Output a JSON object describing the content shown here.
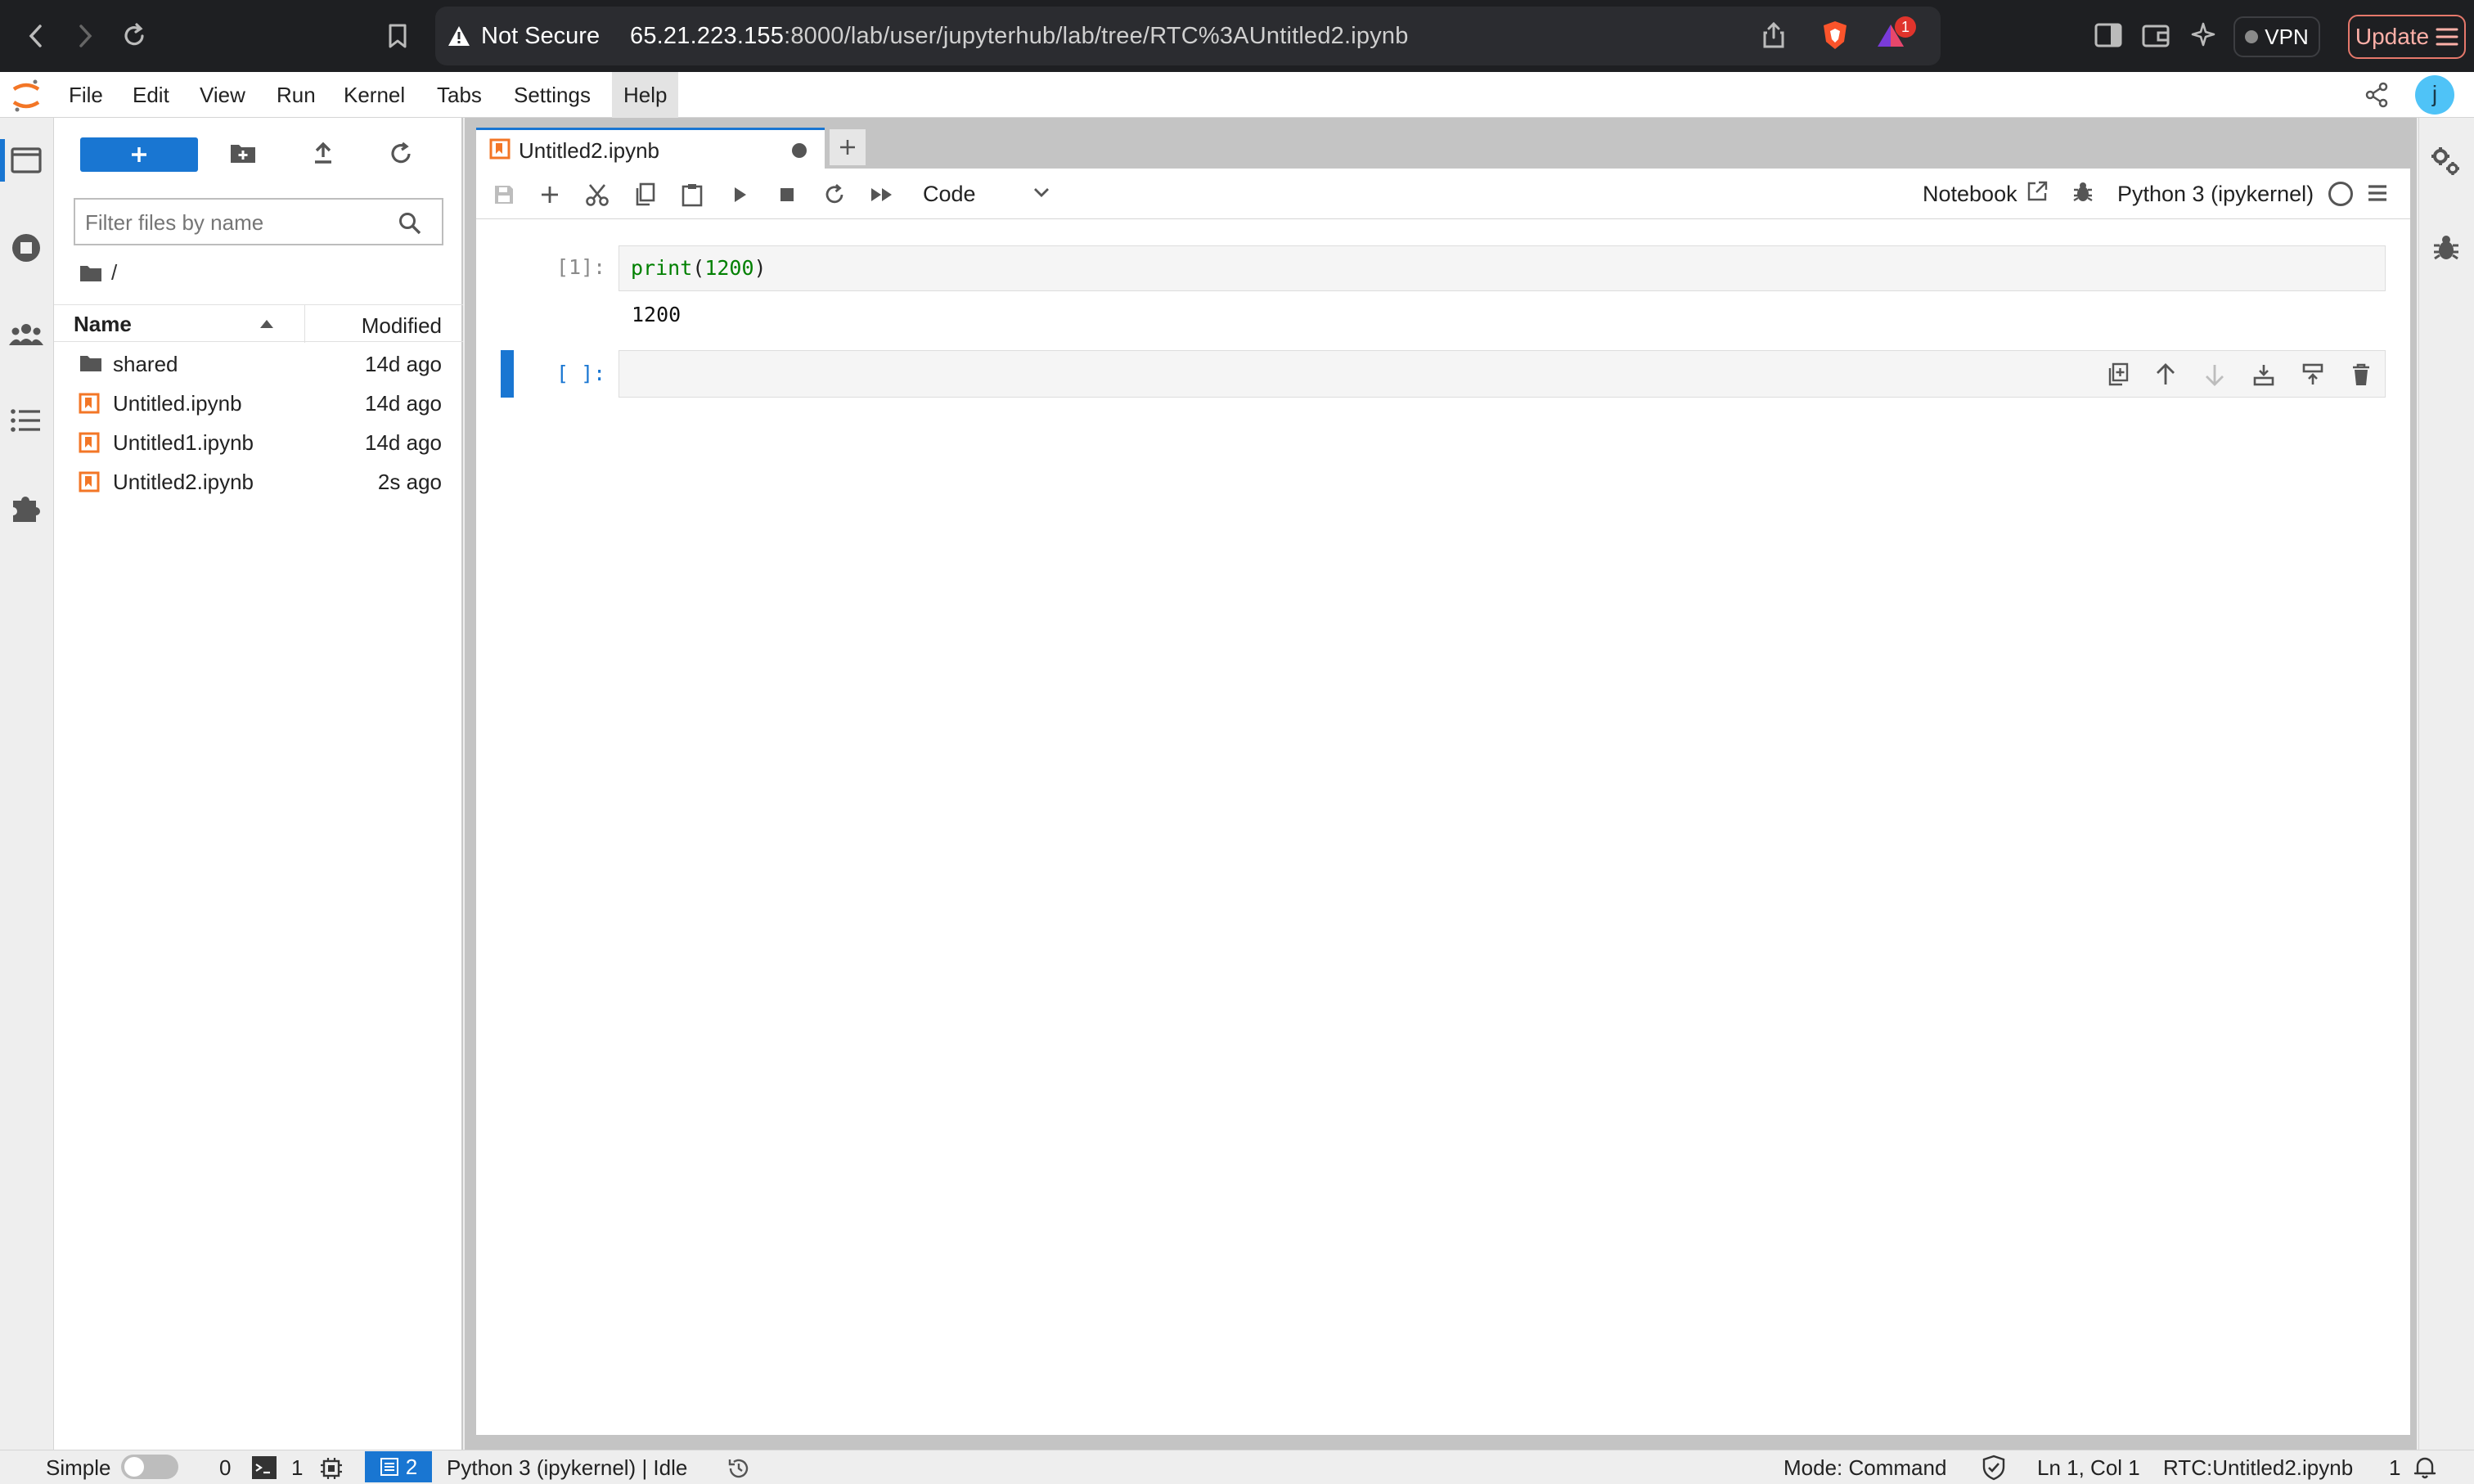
{
  "browser": {
    "security_label": "Not Secure",
    "url_host": "65.21.223.155",
    "url_path": ":8000/lab/user/jupyterhub/lab/tree/RTC%3AUntitled2.ipynb",
    "brave_badge": "1",
    "vpn_label": "VPN",
    "update_label": "Update",
    "accent": "#e6786b"
  },
  "menu": {
    "items": [
      "File",
      "Edit",
      "View",
      "Run",
      "Kernel",
      "Tabs",
      "Settings",
      "Help"
    ],
    "user_initial": "j"
  },
  "filebrowser": {
    "filter_placeholder": "Filter files by name",
    "breadcrumb": "/",
    "col_name": "Name",
    "col_modified": "Modified",
    "files": [
      {
        "name": "shared",
        "modified": "14d ago",
        "type": "folder"
      },
      {
        "name": "Untitled.ipynb",
        "modified": "14d ago",
        "type": "notebook"
      },
      {
        "name": "Untitled1.ipynb",
        "modified": "14d ago",
        "type": "notebook"
      },
      {
        "name": "Untitled2.ipynb",
        "modified": "2s ago",
        "type": "notebook"
      }
    ]
  },
  "notebook": {
    "tab_title": "Untitled2.ipynb",
    "cell_type": "Code",
    "notebook_label": "Notebook",
    "kernel": "Python 3 (ipykernel)",
    "cells": [
      {
        "prompt": "[1]:",
        "code_fn": "print",
        "code_arg": "1200",
        "output": "1200"
      },
      {
        "prompt": "[ ]:"
      }
    ]
  },
  "statusbar": {
    "mode_simple": "Simple",
    "terminals_count": "0",
    "kernels_count": "1",
    "tabs_count": "2",
    "kernel_status": "Python 3 (ipykernel) | Idle",
    "mode": "Mode: Command",
    "position": "Ln 1, Col 1",
    "file": "RTC:Untitled2.ipynb",
    "notifications": "1"
  },
  "colors": {
    "jupyter_blue": "#1976d2",
    "notebook_orange": "#f37626"
  }
}
